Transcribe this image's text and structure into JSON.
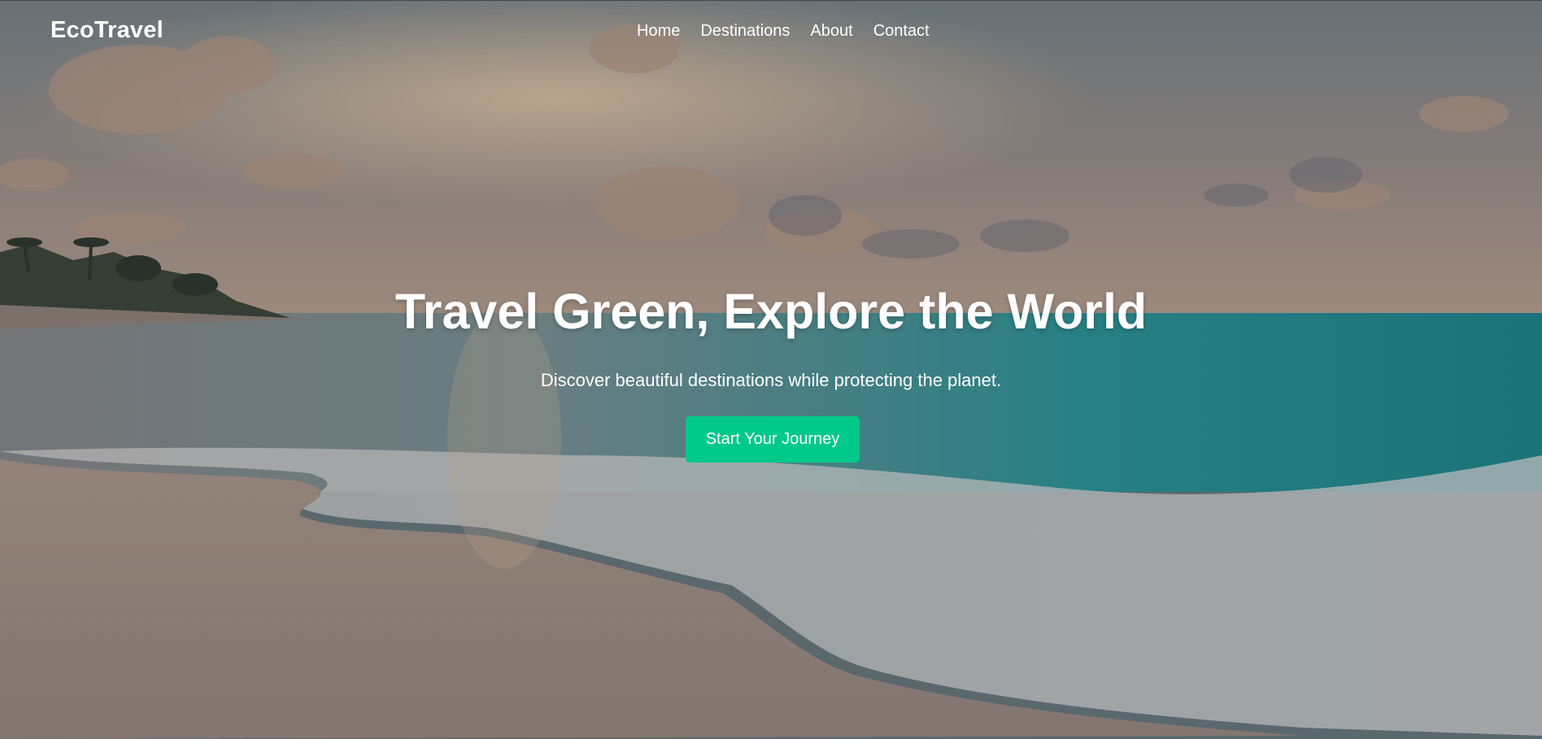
{
  "header": {
    "logo": "EcoTravel",
    "nav": [
      "Home",
      "Destinations",
      "About",
      "Contact"
    ]
  },
  "hero": {
    "title": "Travel Green, Explore the World",
    "subtitle": "Discover beautiful destinations while protecting the planet.",
    "cta_label": "Start Your Journey"
  },
  "colors": {
    "accent": "#00c98a",
    "text": "#ffffff"
  }
}
